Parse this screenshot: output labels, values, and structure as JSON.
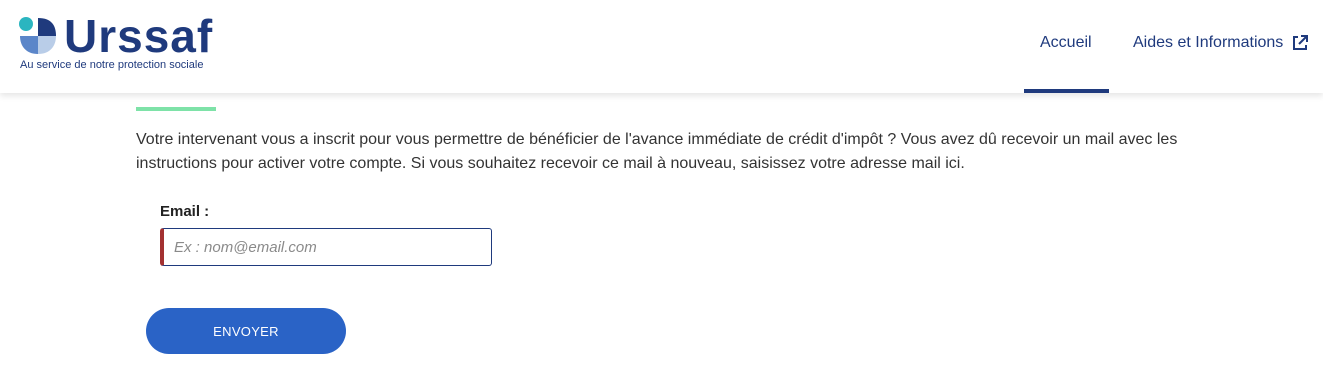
{
  "header": {
    "logo": {
      "word": "Urssaf",
      "tagline": "Au service de notre protection sociale"
    },
    "nav": {
      "accueil": "Accueil",
      "aides": "Aides et Informations",
      "aides_icon": "external-link-icon"
    }
  },
  "main": {
    "intro": "Votre intervenant vous a inscrit pour vous permettre de bénéficier de l'avance immédiate de crédit d'impôt ? Vous avez dû recevoir un mail avec les instructions pour activer votre compte. Si vous souhaitez recevoir ce mail à nouveau, saisissez votre adresse mail ici.",
    "email_label": "Email :",
    "email_placeholder": "Ex : nom@email.com",
    "email_value": "",
    "submit_label": "ENVOYER"
  },
  "colors": {
    "brand": "#1f3a7d",
    "button": "#2a63c6",
    "accent_green": "#7ee2a8",
    "error_border": "#a33131"
  }
}
